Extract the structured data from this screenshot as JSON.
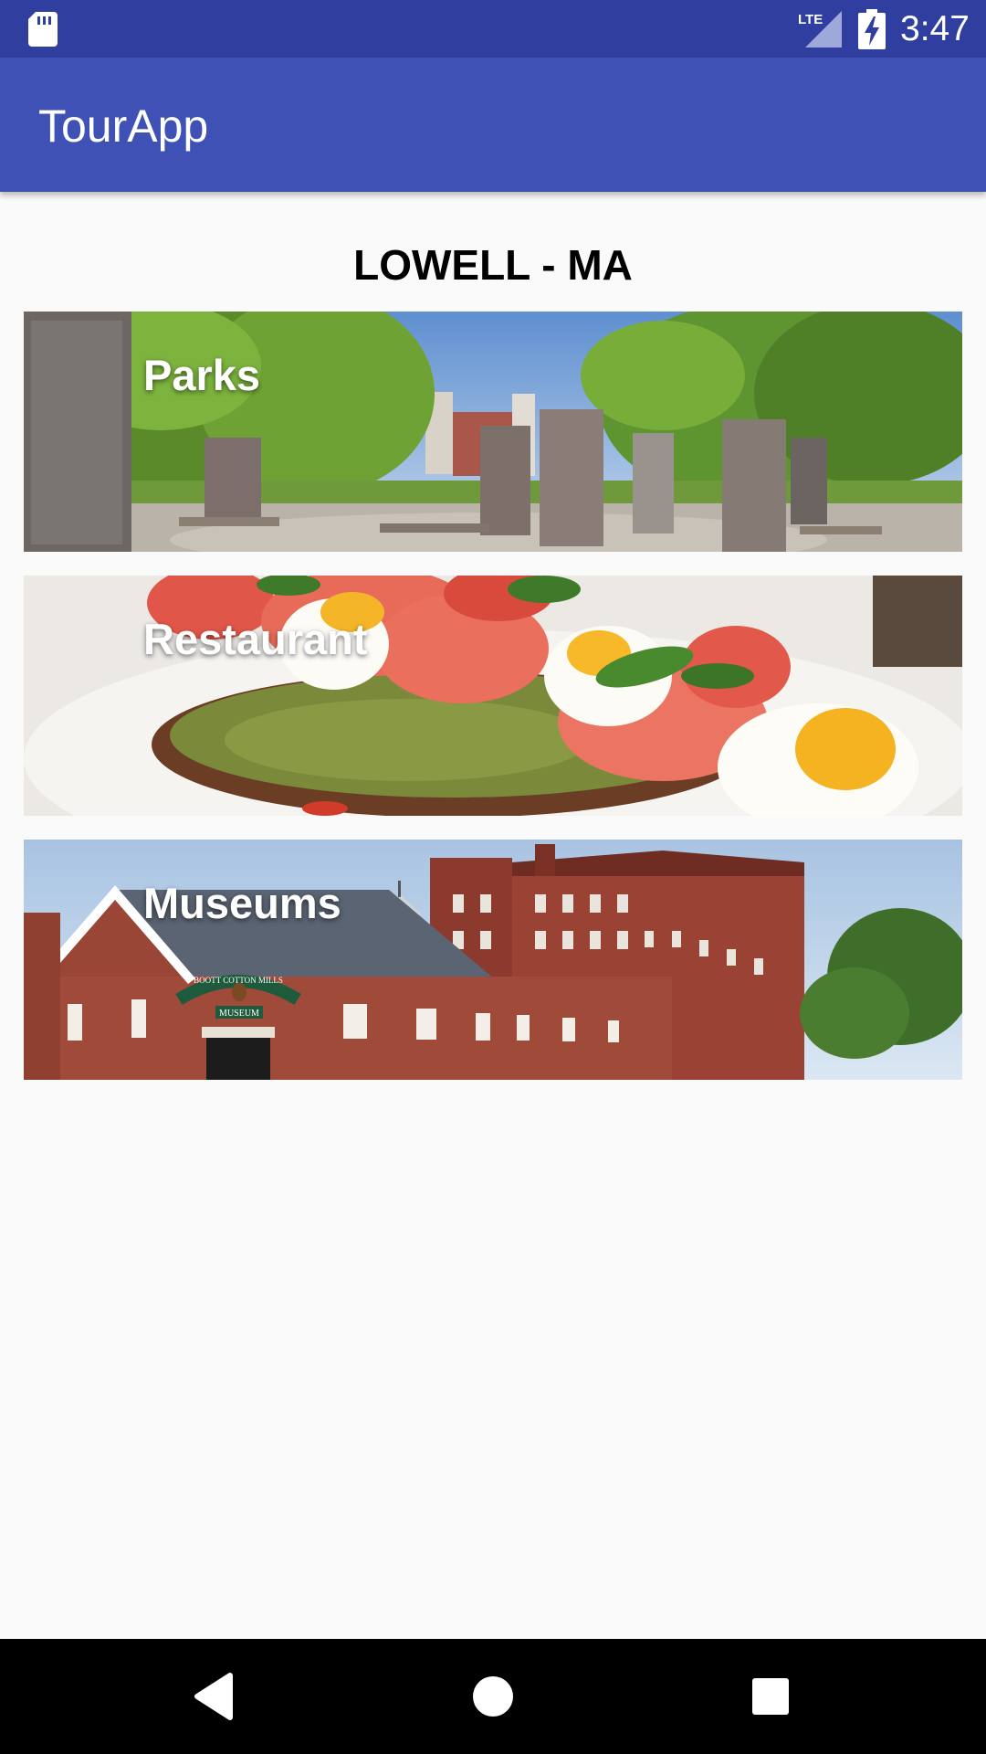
{
  "status_bar": {
    "time": "3:47",
    "network_label": "LTE",
    "icons": [
      "sd-card-icon",
      "lte-signal-icon",
      "battery-charging-icon"
    ]
  },
  "app_bar": {
    "title": "TourApp",
    "color": "#3f51b5"
  },
  "main": {
    "city_title": "LOWELL - MA",
    "categories": [
      {
        "label": "Parks",
        "image": "park-memorial-stones-image"
      },
      {
        "label": "Restaurant",
        "image": "avocado-toast-dish-image"
      },
      {
        "label": "Museums",
        "image": "boott-cotton-mills-museum-image"
      }
    ],
    "museum_sign": {
      "arch": "BOOTT COTTON MILLS",
      "plate": "MUSEUM"
    }
  },
  "nav_bar": {
    "buttons": [
      "back-icon",
      "home-icon",
      "recents-icon"
    ]
  },
  "colors": {
    "status_bar": "#303f9f",
    "app_bar": "#3f51b5",
    "background": "#fafafa",
    "nav_bar": "#000000"
  }
}
